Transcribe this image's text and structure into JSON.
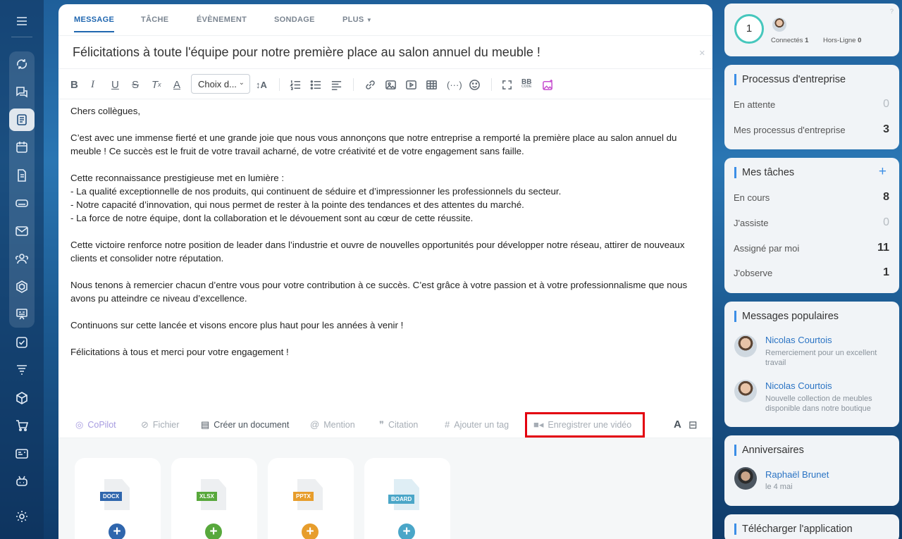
{
  "tabs": [
    {
      "label": "MESSAGE",
      "active": true
    },
    {
      "label": "TÂCHE"
    },
    {
      "label": "ÉVÈNEMENT"
    },
    {
      "label": "SONDAGE"
    },
    {
      "label": "PLUS"
    }
  ],
  "title": "Félicitations à toute l'équipe pour notre première place au salon annuel du meuble !",
  "toolbar": {
    "font_select": "Choix d...",
    "bb_code_top": "BB",
    "bb_code_bottom": "CODE"
  },
  "body": {
    "greeting": "Chers collègues,",
    "p1": "C’est avec une immense fierté et une grande joie que nous vous annonçons que notre entreprise a remporté la première place au salon annuel du meuble ! Ce succès est le fruit de votre travail acharné, de votre créativité et de votre engagement sans faille.",
    "p2_intro": "Cette reconnaissance prestigieuse met en lumière :",
    "p2_items": [
      "- La qualité exceptionnelle de nos produits, qui continuent de séduire et d’impressionner les professionnels du secteur.",
      "- Notre capacité d’innovation, qui nous permet de rester à la pointe des tendances et des attentes du marché.",
      "- La force de notre équipe, dont la collaboration et le dévouement sont au cœur de cette réussite."
    ],
    "p3": "Cette victoire renforce notre position de leader dans l’industrie et ouvre de nouvelles opportunités pour développer notre réseau, attirer de nouveaux clients et consolider notre réputation.",
    "p4": "Nous tenons à remercier chacun d’entre vous pour votre contribution à ce succès. C’est grâce à votre passion et à votre professionnalisme que nous avons pu atteindre ce niveau d’excellence.",
    "p5": "Continuons sur cette lancée et visons encore plus haut pour les années à venir !",
    "p6": "Félicitations à tous et merci pour votre engagement !"
  },
  "bottombar": {
    "copilot": "CoPilot",
    "file": "Fichier",
    "create_doc": "Créer un document",
    "mention": "Mention",
    "quote": "Citation",
    "tag": "Ajouter un tag",
    "video": "Enregistrer une vidéo",
    "font_toggle": "A"
  },
  "files": [
    {
      "label": "DOCX",
      "color": "#2f66ad",
      "plus_color": "#2f66ad"
    },
    {
      "label": "XLSX",
      "color": "#58a83c",
      "plus_color": "#58a83c"
    },
    {
      "label": "PPTX",
      "color": "#e79d2c",
      "plus_color": "#e79d2c"
    },
    {
      "label": "BOARD",
      "color": "#4aa6c8",
      "plus_color": "#4aa6c8"
    }
  ],
  "online": {
    "count": "1",
    "connected_label": "Connectés",
    "connected_value": "1",
    "offline_label": "Hors-Ligne",
    "offline_value": "0"
  },
  "processes": {
    "title": "Processus d'entreprise",
    "rows": [
      {
        "label": "En attente",
        "value": "0"
      },
      {
        "label": "Mes processus d'entreprise",
        "value": "3"
      }
    ]
  },
  "tasks": {
    "title": "Mes tâches",
    "add": "+",
    "rows": [
      {
        "label": "En cours",
        "value": "8"
      },
      {
        "label": "J'assiste",
        "value": "0"
      },
      {
        "label": "Assigné par moi",
        "value": "11"
      },
      {
        "label": "J'observe",
        "value": "1"
      }
    ]
  },
  "popular": {
    "title": "Messages populaires",
    "items": [
      {
        "name": "Nicolas Courtois",
        "text": "Remerciement pour un excellent travail"
      },
      {
        "name": "Nicolas Courtois",
        "text": "Nouvelle collection de meubles disponible dans notre boutique"
      }
    ]
  },
  "birthdays": {
    "title": "Anniversaires",
    "name": "Raphaël Brunet",
    "date": "le 4 mai"
  },
  "app": {
    "title": "Télécharger l'application"
  },
  "colors": {
    "accent": "#2067b0",
    "highlight": "#e3000f",
    "panel_accent": "#3b8ee6"
  }
}
